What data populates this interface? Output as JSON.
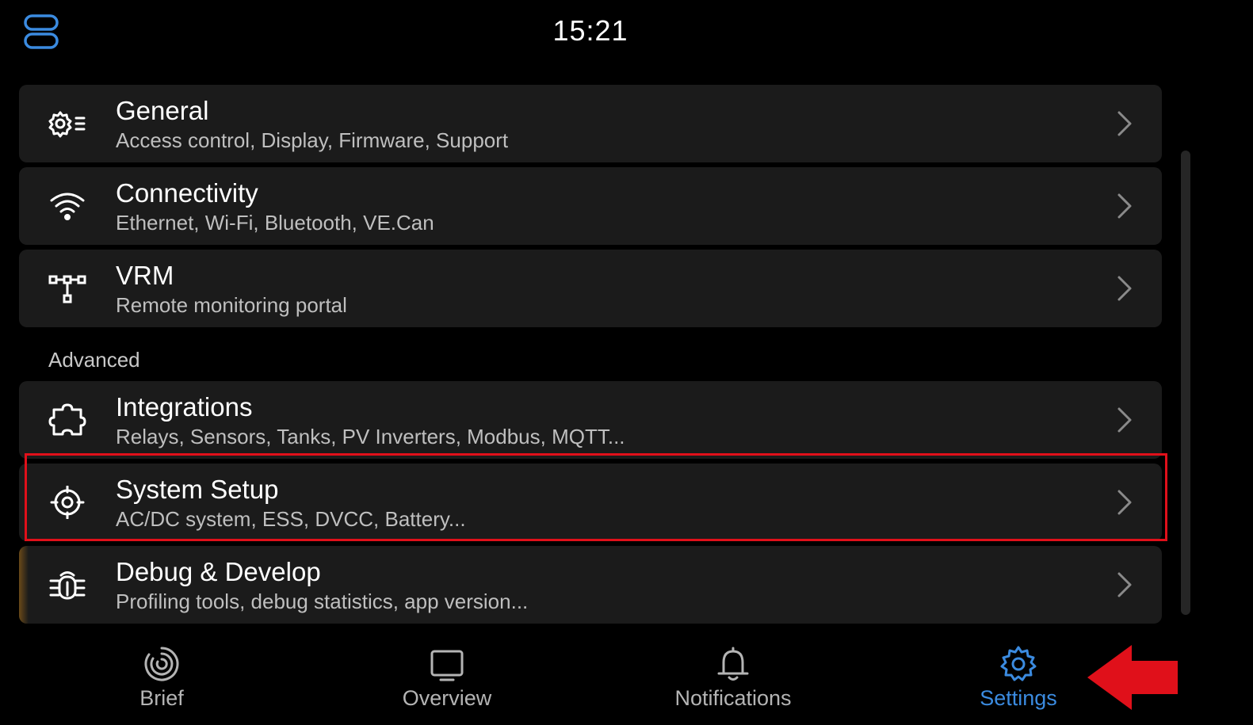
{
  "status_bar": {
    "time": "15:21",
    "toggle_icon": "status-toggle-icon"
  },
  "menu": {
    "items": [
      {
        "title": "General",
        "subtitle": "Access control, Display, Firmware, Support",
        "icon": "gear-list-icon"
      },
      {
        "title": "Connectivity",
        "subtitle": "Ethernet, Wi-Fi, Bluetooth, VE.Can",
        "icon": "wifi-icon"
      },
      {
        "title": "VRM",
        "subtitle": "Remote monitoring portal",
        "icon": "network-icon"
      }
    ],
    "section_label": "Advanced",
    "advanced_items": [
      {
        "title": "Integrations",
        "subtitle": "Relays, Sensors, Tanks, PV Inverters, Modbus, MQTT...",
        "icon": "puzzle-icon"
      },
      {
        "title": "System Setup",
        "subtitle": "AC/DC system, ESS, DVCC, Battery...",
        "icon": "target-gear-icon"
      },
      {
        "title": "Debug & Develop",
        "subtitle": "Profiling tools, debug statistics, app version...",
        "icon": "bug-icon"
      }
    ]
  },
  "bottom_nav": {
    "items": [
      {
        "label": "Brief",
        "icon": "brief-icon"
      },
      {
        "label": "Overview",
        "icon": "overview-icon"
      },
      {
        "label": "Notifications",
        "icon": "bell-icon"
      },
      {
        "label": "Settings",
        "icon": "gear-icon"
      }
    ],
    "active": "Settings"
  },
  "colors": {
    "accent": "#3b8be0",
    "highlight": "#e0101a",
    "card_bg": "#1b1b1b",
    "background": "#000000",
    "subtitle": "#bfbfbf"
  }
}
